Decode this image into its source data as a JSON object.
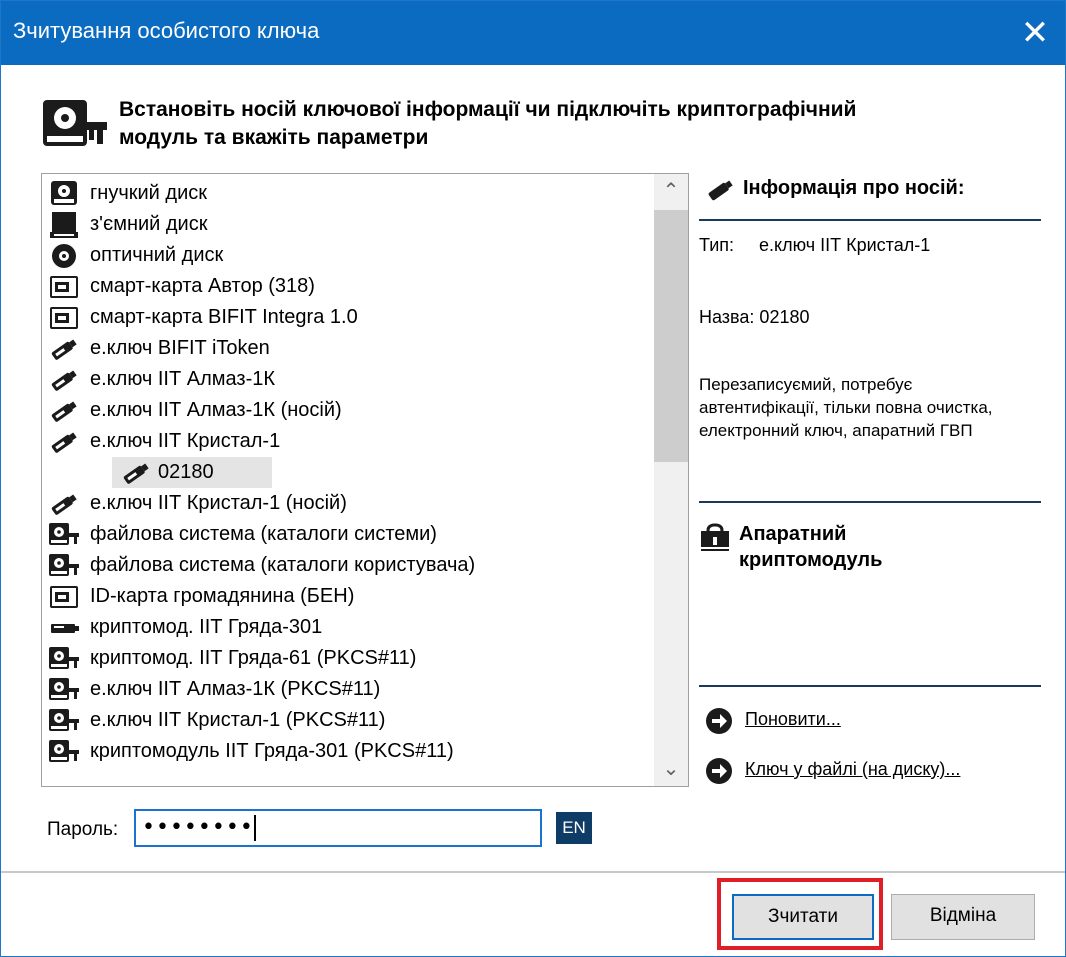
{
  "window": {
    "title": "Зчитування особистого ключа",
    "close_symbol": "✕"
  },
  "header": {
    "line1": "Встановіть носій ключової інформації чи підключіть криптографічний",
    "line2": "модуль та вкажіть параметри",
    "icon": "key-media-icon"
  },
  "list": {
    "items": [
      {
        "label": "гнучкий диск",
        "icon": "floppy-icon"
      },
      {
        "label": "з'ємний диск",
        "icon": "removable-disk-icon"
      },
      {
        "label": "оптичний диск",
        "icon": "optical-disk-icon"
      },
      {
        "label": "смарт-карта Автор (318)",
        "icon": "smart-card-icon"
      },
      {
        "label": "смарт-карта BIFIT Integra 1.0",
        "icon": "smart-card-icon"
      },
      {
        "label": "е.ключ BIFIT iToken",
        "icon": "usb-key-icon"
      },
      {
        "label": "е.ключ ІІТ Алмаз-1К",
        "icon": "usb-key-icon"
      },
      {
        "label": "е.ключ ІІТ Алмаз-1К (носій)",
        "icon": "usb-key-icon"
      },
      {
        "label": "е.ключ ІІТ Кристал-1",
        "icon": "usb-key-icon"
      },
      {
        "label": "02180",
        "icon": "usb-key-icon",
        "selected": true
      },
      {
        "label": "е.ключ ІІТ Кристал-1 (носій)",
        "icon": "usb-key-icon"
      },
      {
        "label": "файлова система (каталоги системи)",
        "icon": "key-media-icon"
      },
      {
        "label": "файлова система (каталоги користувача)",
        "icon": "key-media-icon"
      },
      {
        "label": "ID-карта громадянина (БЕН)",
        "icon": "smart-card-icon"
      },
      {
        "label": "криптомод. ІІТ Гряда-301",
        "icon": "crypto-device-icon"
      },
      {
        "label": "криптомод. ІІТ Гряда-61 (PKCS#11)",
        "icon": "key-media-icon"
      },
      {
        "label": "е.ключ ІІТ Алмаз-1К (PKCS#11)",
        "icon": "key-media-icon"
      },
      {
        "label": "е.ключ ІІТ Кристал-1 (PKCS#11)",
        "icon": "key-media-icon"
      },
      {
        "label": "криптомодуль ІІТ Гряда-301 (PKCS#11)",
        "icon": "key-media-icon"
      }
    ]
  },
  "info": {
    "title": "Інформація про носій:",
    "type_label": "Тип:",
    "type_value": "е.ключ ІІТ Кристал-1",
    "name_line": "Назва: 02180",
    "description": "Перезаписуємий, потребує автентифікації, тільки повна очистка, електронний ключ, апаратний ГВП",
    "crypto_line1": "Апаратний",
    "crypto_line2": "криптомодуль"
  },
  "links": {
    "refresh": "Поновити...",
    "file_key": "Ключ у файлі (на диску)..."
  },
  "password": {
    "label": "Пароль:",
    "value": "••••••••",
    "lang": "EN"
  },
  "buttons": {
    "read": "Зчитати",
    "cancel": "Відміна"
  },
  "colors": {
    "titlebar": "#0a6bc0",
    "highlight": "#e01e28"
  }
}
